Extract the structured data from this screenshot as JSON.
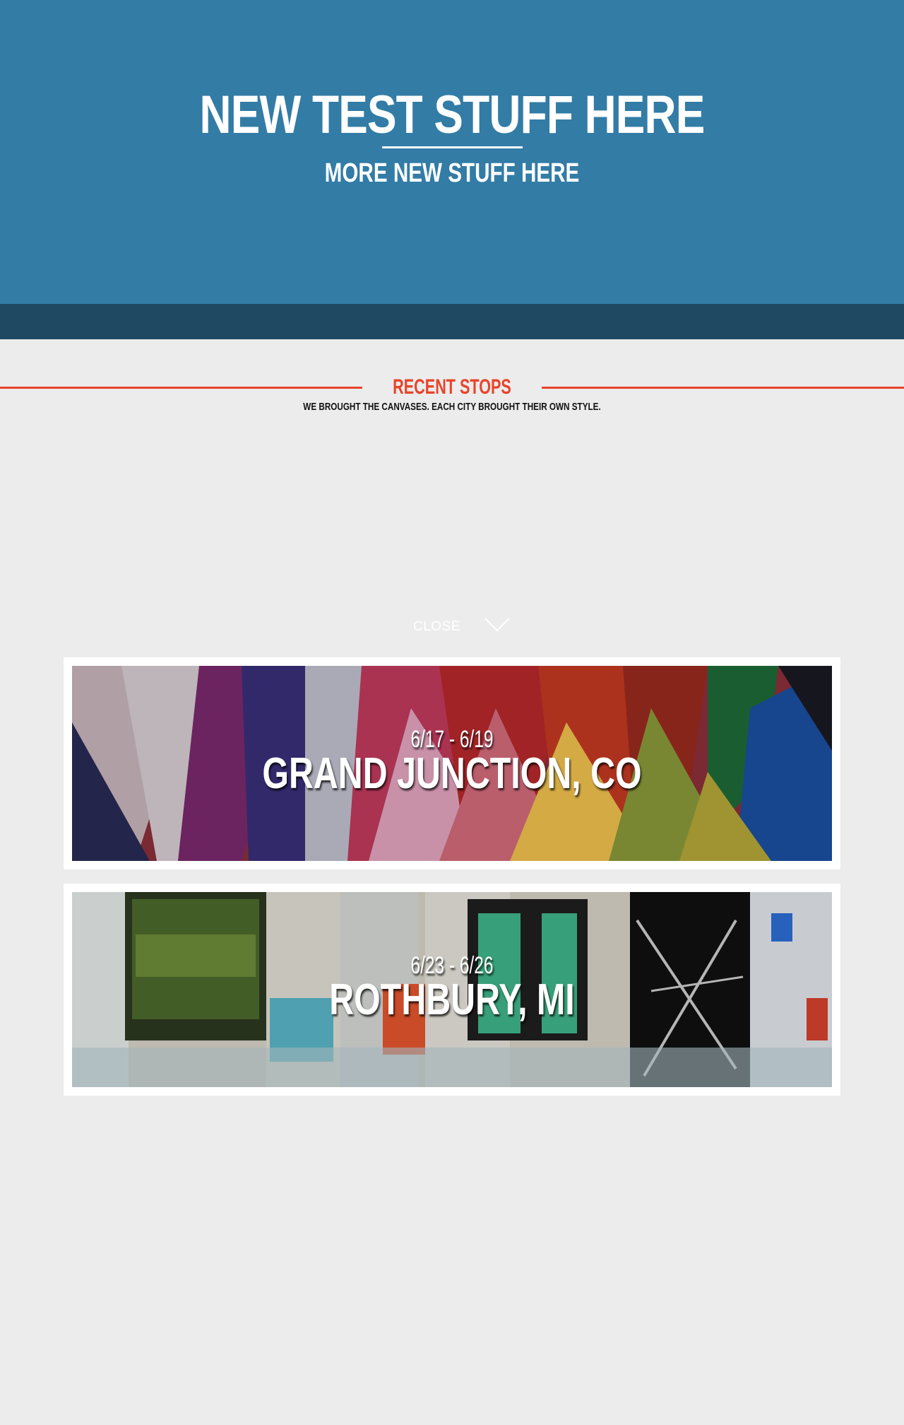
{
  "hero": {
    "title": "NEW TEST STUFF HERE",
    "subtitle": "MORE NEW STUFF HERE",
    "background": "#327ca6"
  },
  "close_bar": {
    "label": "CLOSE",
    "icon": "chevron-down-icon",
    "background": "#1f4863"
  },
  "recent_stops": {
    "title": "RECENT STOPS",
    "subtitle": "WE BROUGHT THE CANVASES. EACH CITY BROUGHT THEIR OWN STYLE.",
    "accent": "#e8442a"
  },
  "stops": [
    {
      "dates": "6/17 - 6/19",
      "city": "GRAND JUNCTION, CO"
    },
    {
      "dates": "6/23 - 6/26",
      "city": "ROTHBURY, MI"
    }
  ]
}
